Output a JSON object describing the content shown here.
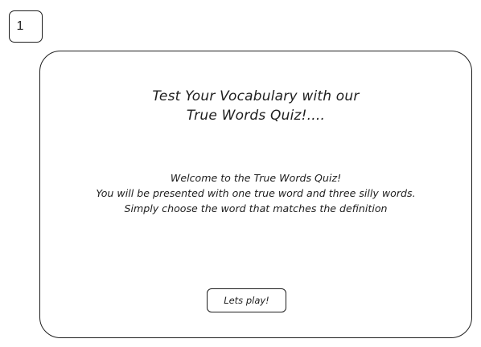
{
  "step_badge": {
    "label": "1"
  },
  "title": {
    "line1": "Test Your Vocabulary with our",
    "line2": "True Words Quiz!...."
  },
  "intro": {
    "line1": "Welcome to the True Words Quiz!",
    "line2": "You will be presented with one true word and three silly words.",
    "line3": "Simply choose the word that matches the definition"
  },
  "actions": {
    "play_label": "Lets play!"
  }
}
